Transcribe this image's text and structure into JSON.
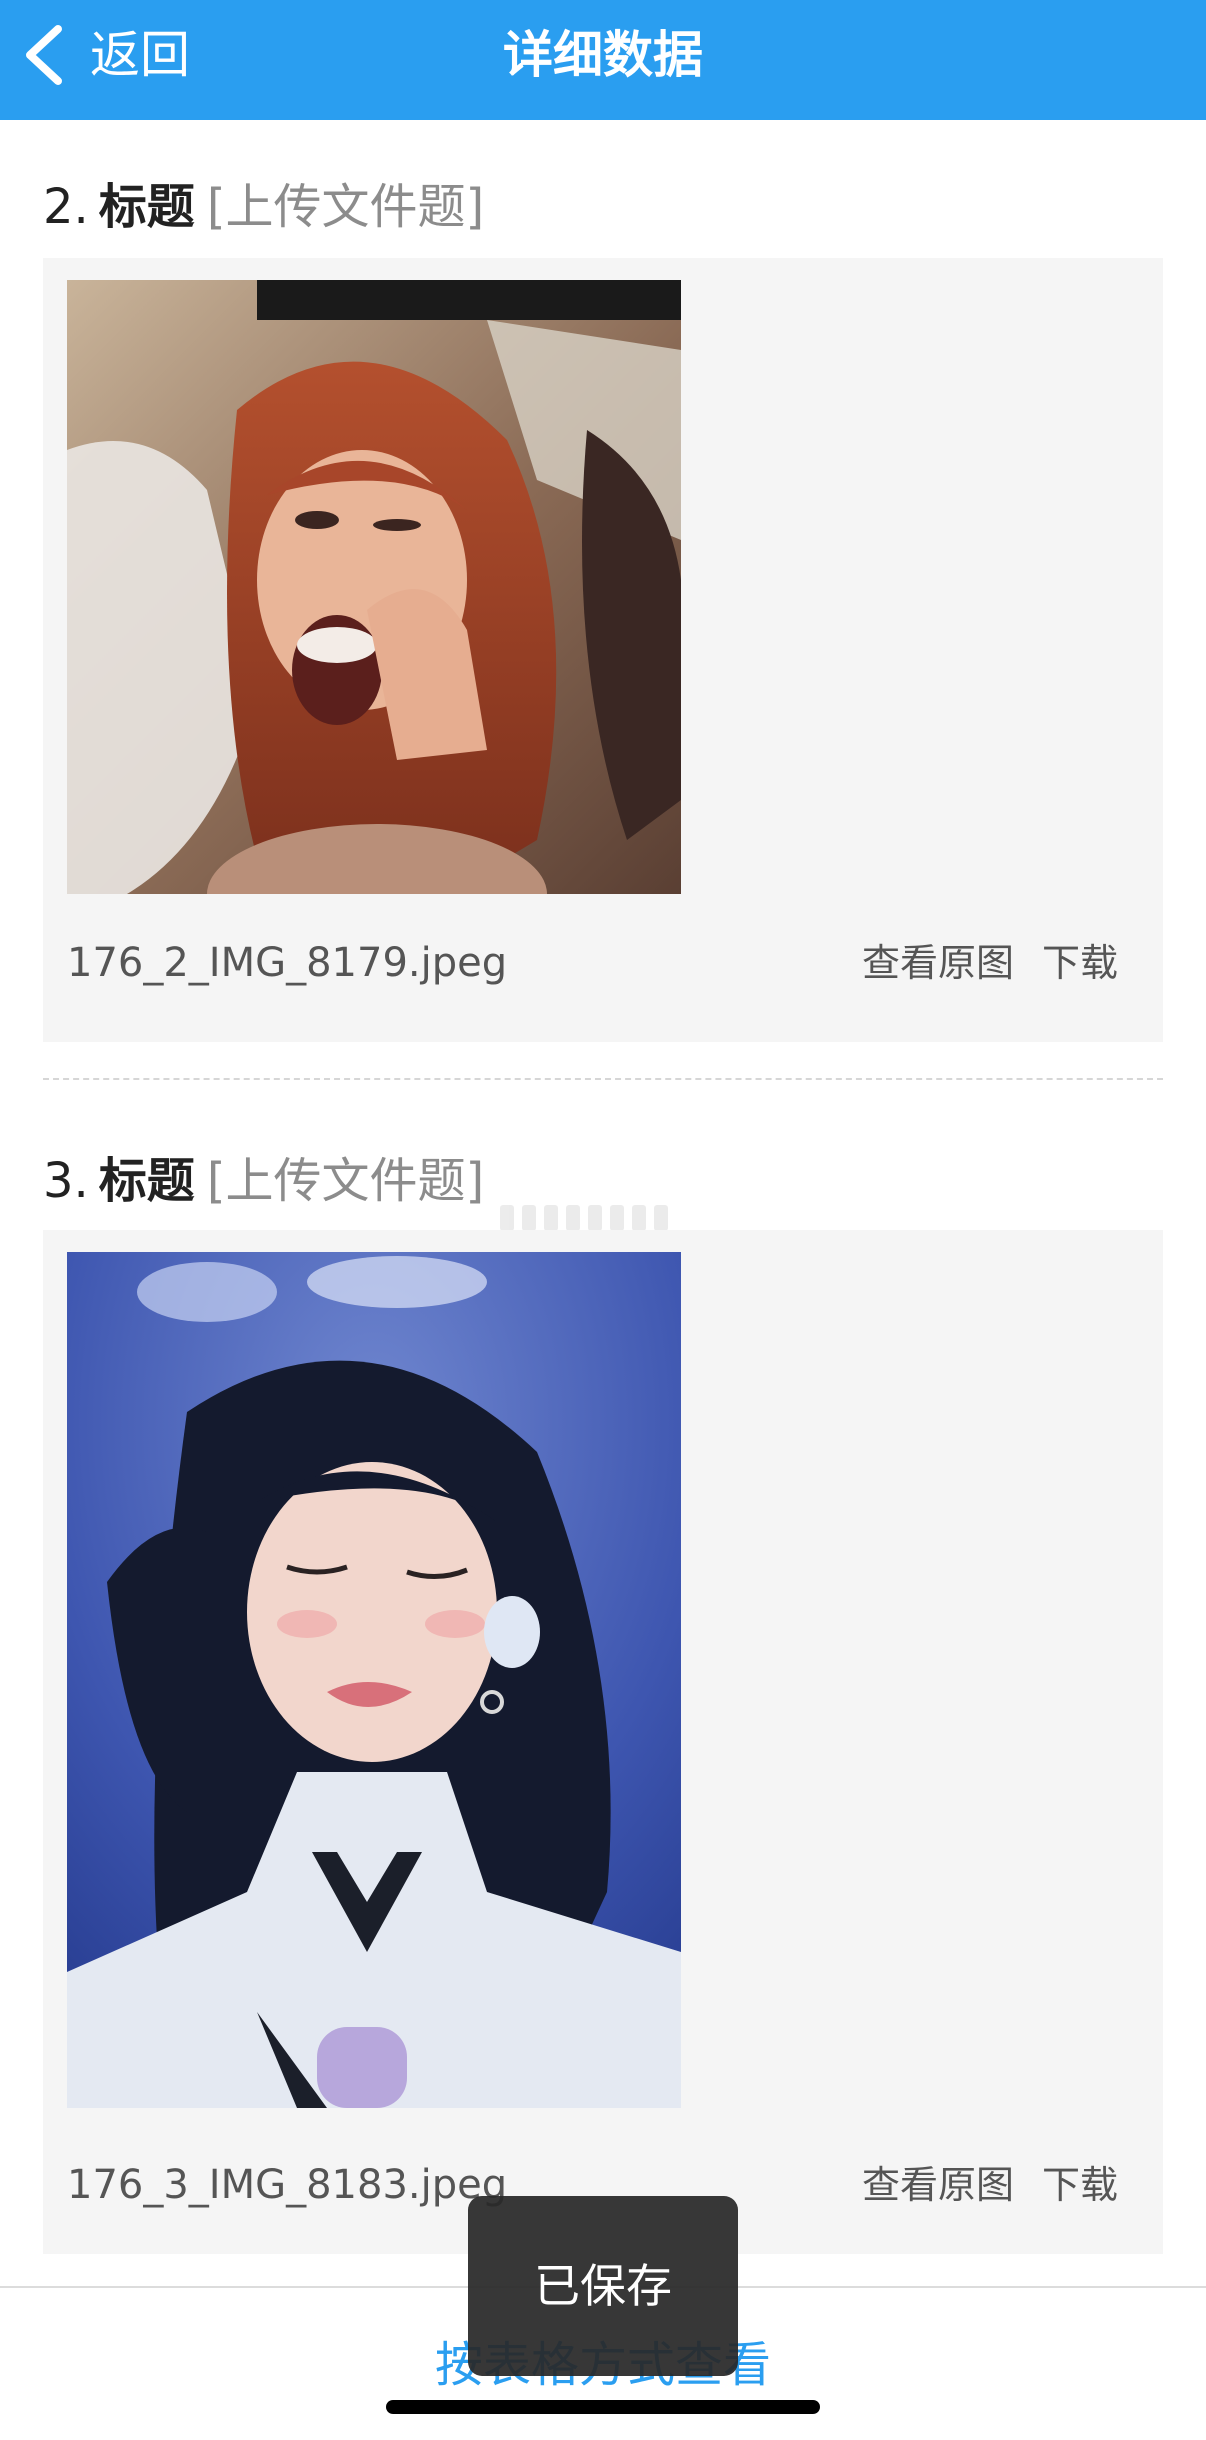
{
  "header": {
    "back_label": "返回",
    "title": "详细数据"
  },
  "questions": [
    {
      "number": "2.",
      "title_word": "标题",
      "type_tag": "[上传文件题]",
      "file_name": "176_2_IMG_8179.jpeg",
      "view_original_label": "查看原图",
      "download_label": "下载"
    },
    {
      "number": "3.",
      "title_word": "标题",
      "type_tag": "[上传文件题]",
      "file_name": "176_3_IMG_8183.jpeg",
      "view_original_label": "查看原图",
      "download_label": "下载"
    }
  ],
  "footer": {
    "table_view_label": "按表格方式查看"
  },
  "toast": {
    "message": "已保存"
  },
  "colors": {
    "header_bg": "#2a9ef0",
    "link": "#2a9ef0",
    "card_bg": "#f5f5f5"
  },
  "icons": {
    "back": "chevron-left-icon"
  }
}
